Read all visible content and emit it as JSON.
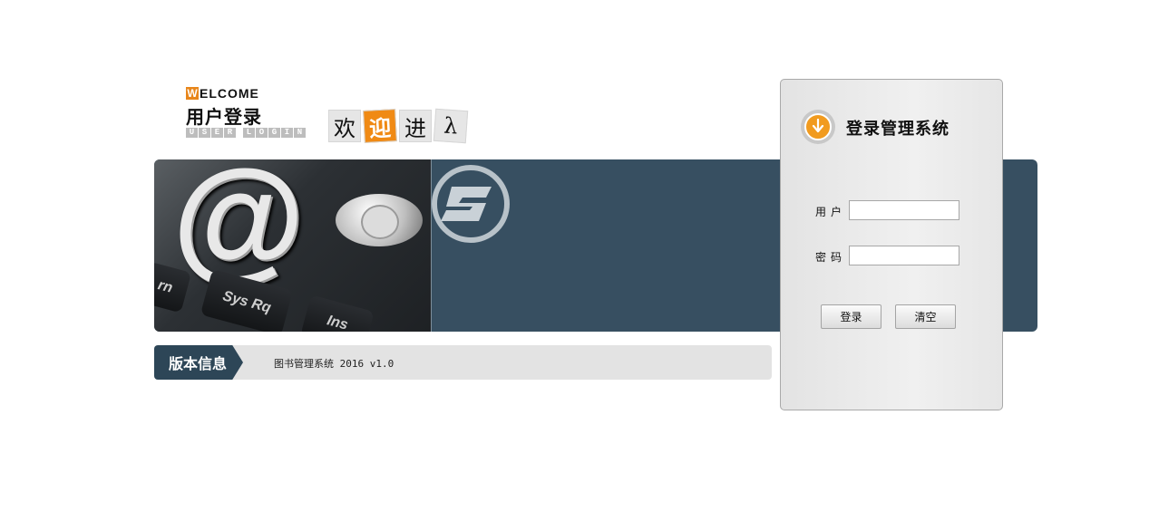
{
  "header": {
    "welcome_initial": "W",
    "welcome_rest": "ELCOME",
    "user_login_cn": "用户登录",
    "user_login_en_letters": [
      "U",
      "S",
      "E",
      "R",
      "",
      "L",
      "O",
      "G",
      "I",
      "N"
    ],
    "welcome_chars": [
      "欢",
      "迎",
      "进",
      "λ"
    ]
  },
  "banner": {
    "keys": [
      "rn",
      "Sys Rq",
      "Ins"
    ],
    "at_symbol": "@"
  },
  "version": {
    "tab_label": "版本信息",
    "text": "图书管理系统 2016 v1.0"
  },
  "login": {
    "title": "登录管理系统",
    "user_label": "用户",
    "user_value": "",
    "password_label": "密码",
    "password_value": "",
    "login_button": "登录",
    "clear_button": "清空"
  },
  "colors": {
    "accent_orange": "#f08a14",
    "banner_blue": "#374f61",
    "tab_blue": "#2d4657"
  },
  "icons": [
    "download-arrow-icon",
    "s-logo-icon",
    "power-button-icon"
  ]
}
